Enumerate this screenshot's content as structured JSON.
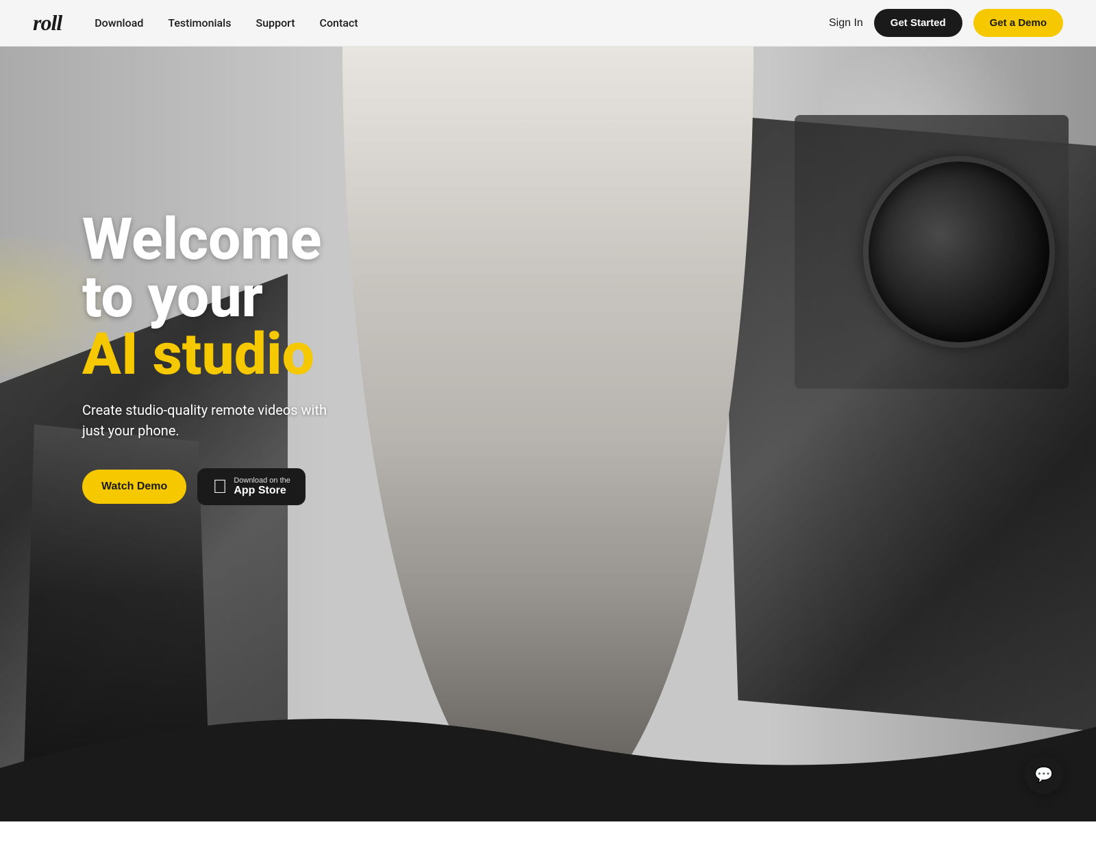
{
  "navbar": {
    "logo": "roll",
    "nav_links": [
      {
        "label": "Download",
        "href": "#"
      },
      {
        "label": "Testimonials",
        "href": "#"
      },
      {
        "label": "Support",
        "href": "#"
      },
      {
        "label": "Contact",
        "href": "#"
      }
    ],
    "sign_in_label": "Sign In",
    "get_started_label": "Get Started",
    "get_demo_label": "Get a Demo"
  },
  "hero": {
    "title_line1": "Welcome",
    "title_line2": "to your",
    "title_line3": "AI studio",
    "subtitle": "Create studio-quality remote videos with just your phone.",
    "watch_demo_label": "Watch Demo",
    "app_store_small": "Download on the",
    "app_store_big": "App Store"
  },
  "chat": {
    "icon": "💬"
  }
}
